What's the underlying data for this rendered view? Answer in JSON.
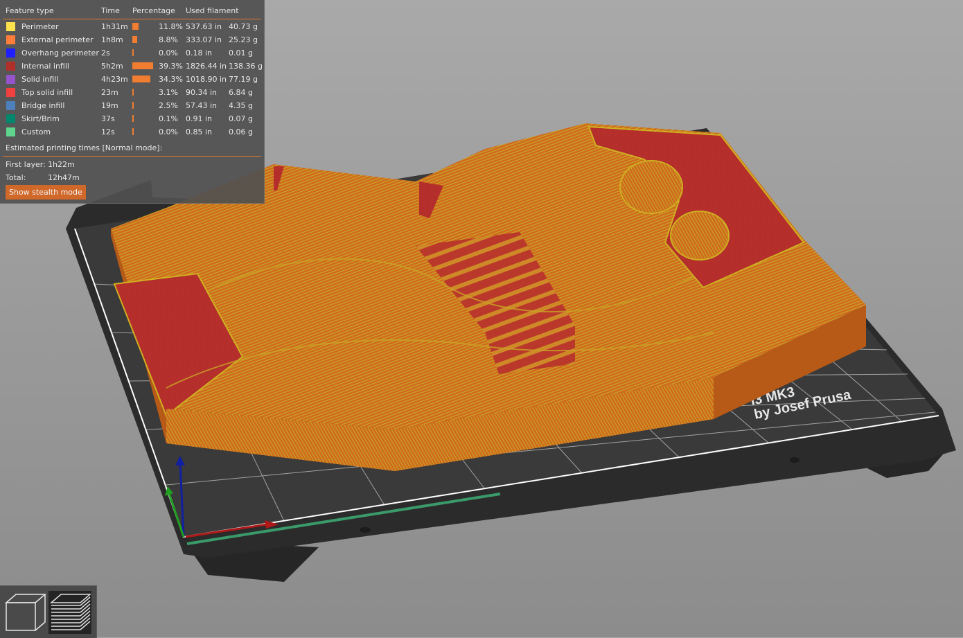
{
  "legend": {
    "headers": {
      "feature_type": "Feature type",
      "time": "Time",
      "percentage": "Percentage",
      "used_filament": "Used filament"
    },
    "rows": [
      {
        "name": "Perimeter",
        "color": "#ffe34d",
        "time": "1h31m",
        "percent": 11.8,
        "percent_label": "11.8%",
        "length": "537.63 in",
        "weight": "40.73 g"
      },
      {
        "name": "External perimeter",
        "color": "#ff7d38",
        "time": "1h8m",
        "percent": 8.8,
        "percent_label": "8.8%",
        "length": "333.07 in",
        "weight": "25.23 g"
      },
      {
        "name": "Overhang perimeter",
        "color": "#1f1fff",
        "time": "2s",
        "percent": 0.0,
        "percent_label": "0.0%",
        "length": "0.18 in",
        "weight": "0.01 g"
      },
      {
        "name": "Internal infill",
        "color": "#b03029",
        "time": "5h2m",
        "percent": 39.3,
        "percent_label": "39.3%",
        "length": "1826.44 in",
        "weight": "138.36 g"
      },
      {
        "name": "Solid infill",
        "color": "#9654cc",
        "time": "4h23m",
        "percent": 34.3,
        "percent_label": "34.3%",
        "length": "1018.90 in",
        "weight": "77.19 g"
      },
      {
        "name": "Top solid infill",
        "color": "#f04040",
        "time": "23m",
        "percent": 3.1,
        "percent_label": "3.1%",
        "length": "90.34 in",
        "weight": "6.84 g"
      },
      {
        "name": "Bridge infill",
        "color": "#4d80ba",
        "time": "19m",
        "percent": 2.5,
        "percent_label": "2.5%",
        "length": "57.43 in",
        "weight": "4.35 g"
      },
      {
        "name": "Skirt/Brim",
        "color": "#00876e",
        "time": "37s",
        "percent": 0.1,
        "percent_label": "0.1%",
        "length": "0.91 in",
        "weight": "0.07 g"
      },
      {
        "name": "Custom",
        "color": "#5ed48c",
        "time": "12s",
        "percent": 0.0,
        "percent_label": "0.0%",
        "length": "0.85 in",
        "weight": "0.06 g"
      }
    ],
    "estimated_title": "Estimated printing times [Normal mode]:",
    "first_layer_label": "First layer:",
    "first_layer_value": "1h22m",
    "total_label": "Total:",
    "total_value": "12h47m",
    "stealth_button": "Show stealth mode"
  },
  "bed": {
    "label_line1": "i3 MK3",
    "label_line2": "by Josef Prusa"
  },
  "toolbar": {
    "view_3d_icon": "cube-icon",
    "preview_icon": "layers-icon"
  },
  "colors": {
    "accent": "#e07a30",
    "print_orange": "#d2691e",
    "print_red": "#b53030",
    "perimeter_yellow": "#c8b020"
  }
}
